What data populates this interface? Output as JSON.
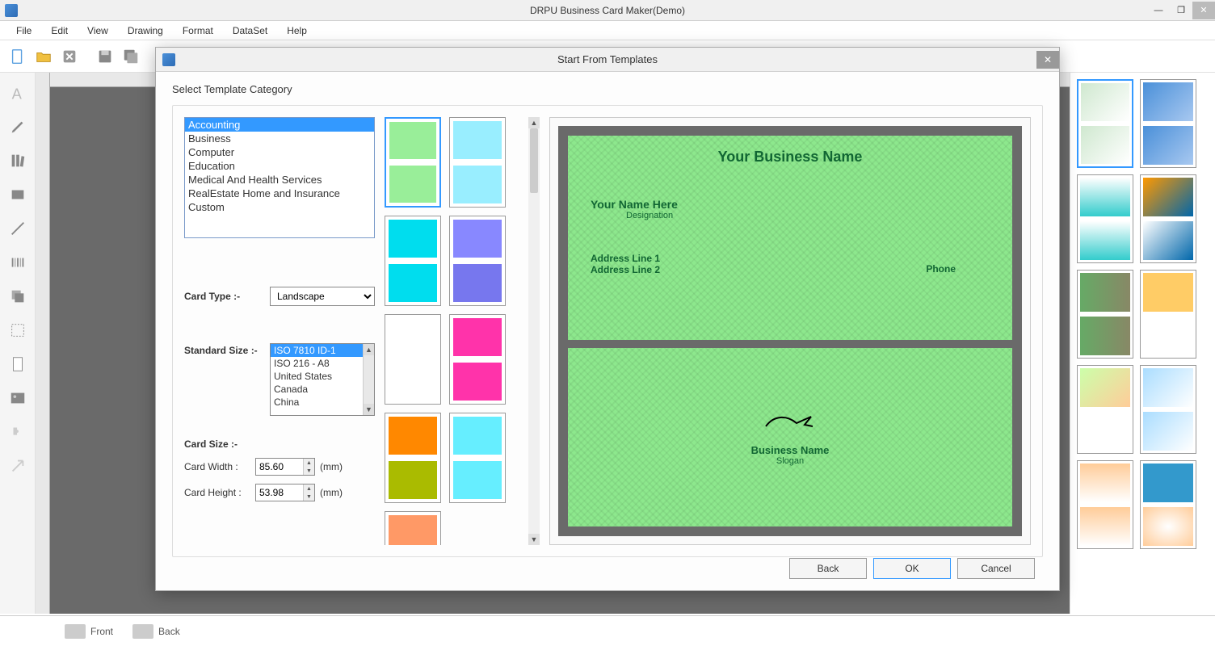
{
  "titlebar": {
    "title": "DRPU Business Card Maker(Demo)"
  },
  "menu": {
    "file": "File",
    "edit": "Edit",
    "view": "View",
    "drawing": "Drawing",
    "format": "Format",
    "dataset": "DataSet",
    "help": "Help"
  },
  "dialog": {
    "title": "Start From Templates",
    "section_label": "Select Template Category",
    "categories": [
      "Accounting",
      "Business",
      "Computer",
      "Education",
      "Medical And Health Services",
      "RealEstate Home and Insurance",
      "Custom"
    ],
    "card_type_label": "Card Type :-",
    "card_type_value": "Landscape",
    "std_size_label": "Standard Size :-",
    "std_sizes": [
      "ISO 7810 ID-1",
      "ISO 216 - A8",
      "United States",
      "Canada",
      "China"
    ],
    "card_size_label": "Card Size :-",
    "width_label": "Card Width :",
    "width_value": "85.60",
    "height_label": "Card Height :",
    "height_value": "53.98",
    "unit": "(mm)",
    "buttons": {
      "back": "Back",
      "ok": "OK",
      "cancel": "Cancel"
    }
  },
  "preview": {
    "business_name": "Your Business Name",
    "your_name": "Your Name Here",
    "designation": "Designation",
    "addr1": "Address Line 1",
    "addr2": "Address Line 2",
    "phone": "Phone",
    "back_name": "Business Name",
    "slogan": "Slogan"
  },
  "status": {
    "front": "Front",
    "back": "Back"
  }
}
